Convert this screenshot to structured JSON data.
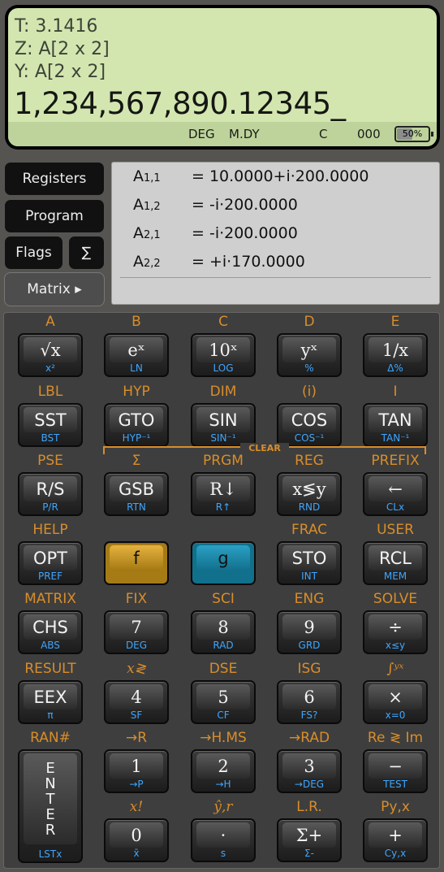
{
  "display": {
    "t_reg": "T:  3.1416",
    "z_reg": "Z: A[2 x 2]",
    "y_reg": "Y: A[2 x 2]",
    "x_reg": "1,234,567,890.12345_",
    "status": {
      "angle": "DEG",
      "date": "M.DY",
      "complex": "C",
      "flags": "000",
      "battery": "50%",
      "battery_level": 0.5
    }
  },
  "side_buttons": {
    "registers": "Registers",
    "program": "Program",
    "flags": "Flags",
    "sum": "∑",
    "matrix": "Matrix ▸"
  },
  "matrix": [
    {
      "name": "A",
      "sub": "1,1",
      "value": "= 10.0000+i·200.0000"
    },
    {
      "name": "A",
      "sub": "1,2",
      "value": "= -i·200.0000"
    },
    {
      "name": "A",
      "sub": "2,1",
      "value": "= -i·200.0000"
    },
    {
      "name": "A",
      "sub": "2,2",
      "value": "= +i·170.0000"
    }
  ],
  "clear_label": "CLEAR",
  "keys": [
    [
      {
        "f": "A",
        "main": "√x",
        "g": "x²"
      },
      {
        "f": "B",
        "main": "eˣ",
        "g": "LN"
      },
      {
        "f": "C",
        "main": "10ˣ",
        "g": "LOG"
      },
      {
        "f": "D",
        "main": "yˣ",
        "g": "%"
      },
      {
        "f": "E",
        "main": "1/x",
        "g": "Δ%"
      }
    ],
    [
      {
        "f": "LBL",
        "main": "SST",
        "g": "BST"
      },
      {
        "f": "HYP",
        "main": "GTO",
        "g": "HYP⁻¹"
      },
      {
        "f": "DIM",
        "main": "SIN",
        "g": "SIN⁻¹"
      },
      {
        "f": "(i)",
        "main": "COS",
        "g": "COS⁻¹"
      },
      {
        "f": "I",
        "main": "TAN",
        "g": "TAN⁻¹"
      }
    ],
    [
      {
        "f": "PSE",
        "main": "R/S",
        "g": "P/R"
      },
      {
        "f": "Σ",
        "main": "GSB",
        "g": "RTN"
      },
      {
        "f": "PRGM",
        "main": "R↓",
        "g": "R↑"
      },
      {
        "f": "REG",
        "main": "x≶y",
        "g": "RND"
      },
      {
        "f": "PREFIX",
        "main": "←",
        "g": "CLx"
      }
    ],
    [
      {
        "f": "HELP",
        "main": "OPT",
        "g": "PREF"
      },
      {
        "f": "",
        "main": "f",
        "g": ""
      },
      {
        "f": "",
        "main": "g",
        "g": ""
      },
      {
        "f": "FRAC",
        "main": "STO",
        "g": "INT"
      },
      {
        "f": "USER",
        "main": "RCL",
        "g": "MEM"
      }
    ],
    [
      {
        "f": "MATRIX",
        "main": "CHS",
        "g": "ABS"
      },
      {
        "f": "FIX",
        "main": "7",
        "g": "DEG"
      },
      {
        "f": "SCI",
        "main": "8",
        "g": "RAD"
      },
      {
        "f": "ENG",
        "main": "9",
        "g": "GRD"
      },
      {
        "f": "SOLVE",
        "main": "÷",
        "g": "x≤y"
      }
    ],
    [
      {
        "f": "RESULT",
        "main": "EEX",
        "g": "π"
      },
      {
        "f": "x≷",
        "main": "4",
        "g": "SF"
      },
      {
        "f": "DSE",
        "main": "5",
        "g": "CF"
      },
      {
        "f": "ISG",
        "main": "6",
        "g": "FS?"
      },
      {
        "f": "∫ʸˣ",
        "main": "×",
        "g": "x=0"
      }
    ],
    [
      {
        "f": "RAN#",
        "main": "ENTER",
        "g": "LSTx"
      },
      {
        "f": "→R",
        "main": "1",
        "g": "→P"
      },
      {
        "f": "→H.MS",
        "main": "2",
        "g": "→H"
      },
      {
        "f": "→RAD",
        "main": "3",
        "g": "→DEG"
      },
      {
        "f": "Re ≷ Im",
        "main": "−",
        "g": "TEST"
      }
    ],
    [
      {
        "f": "x!",
        "main": "0",
        "g": "x̄"
      },
      {
        "f": "ŷ,r",
        "main": "·",
        "g": "s"
      },
      {
        "f": "L.R.",
        "main": "Σ+",
        "g": "Σ-"
      },
      {
        "f": "Py,x",
        "main": "+",
        "g": "Cy,x"
      }
    ]
  ]
}
